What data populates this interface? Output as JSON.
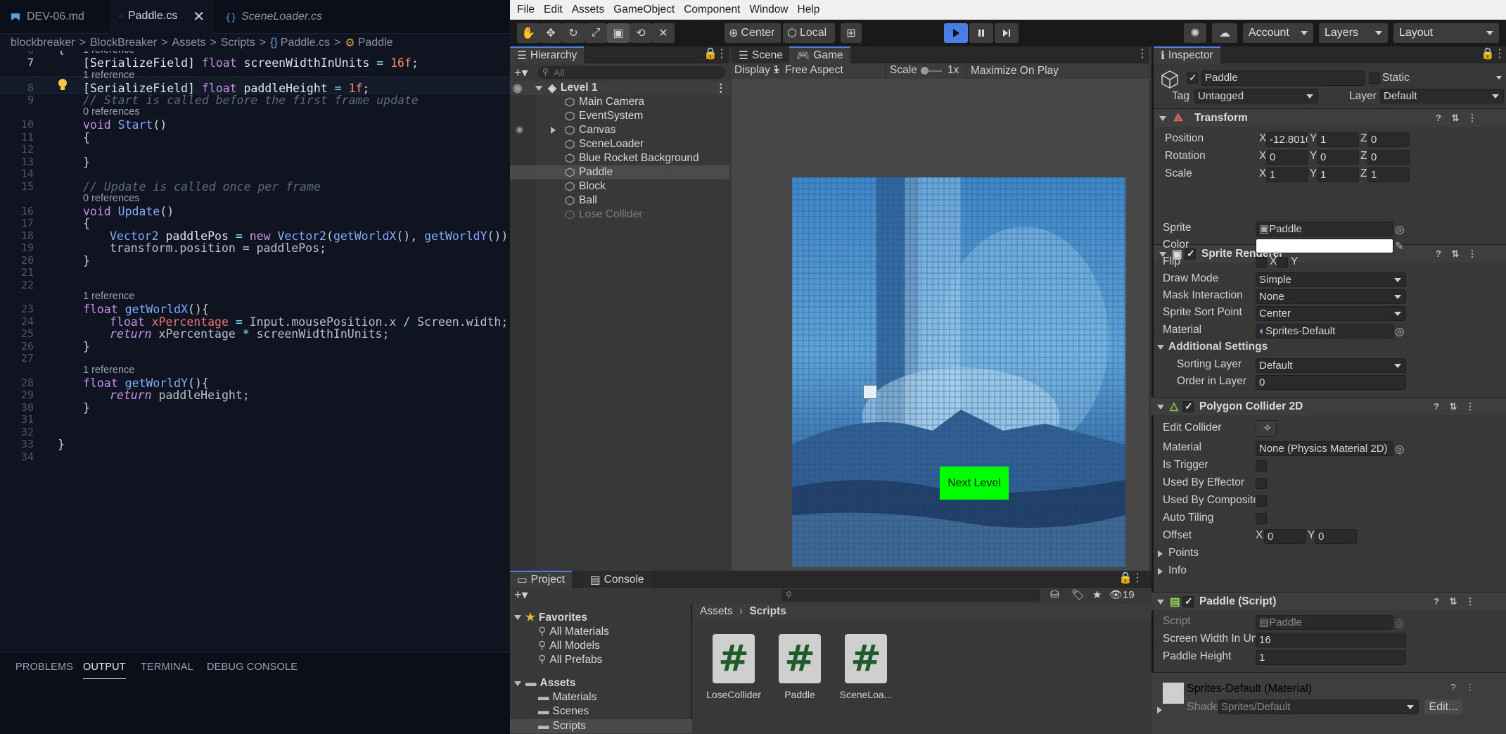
{
  "vscode": {
    "tabs": [
      {
        "label": "DEV-06.md",
        "italic": false
      },
      {
        "label": "Paddle.cs",
        "italic": false
      },
      {
        "label": "SceneLoader.cs",
        "italic": true
      }
    ],
    "breadcrumb": [
      "blockbreaker",
      "BlockBreaker",
      "Assets",
      "Scripts",
      "Paddle.cs",
      "Paddle"
    ],
    "breadcrumb_sep": ">",
    "line_numbers": [
      "6",
      "7",
      "8",
      "9",
      "10",
      "11",
      "12",
      "13",
      "14",
      "15",
      "16",
      "17",
      "18",
      "19",
      "20",
      "21",
      "22",
      "23",
      "24",
      "25",
      "26",
      "27",
      "28",
      "29",
      "30",
      "31",
      "32",
      "33",
      "34"
    ],
    "codelens": {
      "one_ref": "1 reference",
      "zero_ref": "0 references"
    },
    "code": {
      "l6": "{",
      "l7a": "[SerializeField] ",
      "l7b": "float ",
      "l7c": "screenWidthInUnits",
      "l7d": " = ",
      "l7e": "16f",
      "l7f": ";",
      "l8a": "[SerializeField] ",
      "l8b": "float ",
      "l8c": "paddleHeight",
      "l8d": " = ",
      "l8e": "1f",
      "l8f": ";",
      "l9": "// Start is called before the first frame update",
      "l10a": "void ",
      "l10b": "Start",
      "l10c": "()",
      "l11": "{",
      "l13": "}",
      "l15": "// Update is called once per frame",
      "l16a": "void ",
      "l16b": "Update",
      "l16c": "()",
      "l17": "{",
      "l18a": "Vector2 ",
      "l18b": "paddlePos",
      "l18c": " = ",
      "l18d": "new ",
      "l18e": "Vector2",
      "l18f": "(",
      "l18g": "getWorldX",
      "l18h": "(), ",
      "l18i": "getWorldY",
      "l18j": "());",
      "l19": "transform.position = paddlePos;",
      "l20": "}",
      "l23a": "float ",
      "l23b": "getWorldX",
      "l23c": "(){",
      "l24a": "float ",
      "l24b": "xPercentage",
      "l24c": " = ",
      "l24d": "Input.mousePosition.x ",
      "l24e": "/",
      "l24f": " Screen.width;",
      "l25a": "return ",
      "l25b": "xPercentage ",
      "l25c": "*",
      "l25d": " screenWidthInUnits;",
      "l26": "}",
      "l28a": "float ",
      "l28b": "getWorldY",
      "l28c": "(){",
      "l29a": "return ",
      "l29b": "paddleHeight;",
      "l30": "}",
      "l33": "}"
    },
    "panel_tabs": [
      "PROBLEMS",
      "OUTPUT",
      "TERMINAL",
      "DEBUG CONSOLE"
    ]
  },
  "unity": {
    "menu": [
      "File",
      "Edit",
      "Assets",
      "GameObject",
      "Component",
      "Window",
      "Help"
    ],
    "toolbar": {
      "center": "Center",
      "local": "Local",
      "account": "Account",
      "layers": "Layers",
      "layout": "Layout"
    },
    "hierarchy": {
      "title": "Hierarchy",
      "search_placeholder": "All",
      "scene": "Level 1",
      "items": [
        "Main Camera",
        "EventSystem",
        "Canvas",
        "SceneLoader",
        "Blue Rocket Background",
        "Paddle",
        "Block",
        "Ball",
        "Lose Collider"
      ]
    },
    "game": {
      "tab_scene": "Scene",
      "tab_game": "Game",
      "display": "Display 1",
      "aspect": "Free Aspect",
      "scale_label": "Scale",
      "scale_value": "1x",
      "maximize": "Maximize On Play",
      "next_level": "Next Level"
    },
    "project": {
      "tab_project": "Project",
      "tab_console": "Console",
      "count": "19",
      "favorites": "Favorites",
      "fav_items": [
        "All Materials",
        "All Models",
        "All Prefabs"
      ],
      "assets": "Assets",
      "folders": [
        "Materials",
        "Scenes",
        "Scripts"
      ],
      "breadcrumb_root": "Assets",
      "breadcrumb_leaf": "Scripts",
      "files": [
        "LoseCollider",
        "Paddle",
        "SceneLoa..."
      ],
      "file_glyph": "#"
    },
    "inspector": {
      "title": "Inspector",
      "object_name": "Paddle",
      "static": "Static",
      "tag_label": "Tag",
      "tag": "Untagged",
      "layer_label": "Layer",
      "layer": "Default",
      "transform": {
        "title": "Transform",
        "position": {
          "label": "Position",
          "x": "-12.80169",
          "y": "1",
          "z": "0"
        },
        "rotation": {
          "label": "Rotation",
          "x": "0",
          "y": "0",
          "z": "0"
        },
        "scale": {
          "label": "Scale",
          "x": "1",
          "y": "1",
          "z": "1"
        }
      },
      "axis": {
        "x": "X",
        "y": "Y",
        "z": "Z"
      },
      "sprite_renderer": {
        "title": "Sprite Renderer",
        "sprite_label": "Sprite",
        "sprite": "Paddle",
        "color_label": "Color",
        "color": "#ffffff",
        "flip_label": "Flip",
        "draw_mode_label": "Draw Mode",
        "draw_mode": "Simple",
        "mask_label": "Mask Interaction",
        "mask": "None",
        "sort_point_label": "Sprite Sort Point",
        "sort_point": "Center",
        "material_label": "Material",
        "material": "Sprites-Default",
        "additional": "Additional Settings",
        "sorting_layer_label": "Sorting Layer",
        "sorting_layer": "Default",
        "order_label": "Order in Layer",
        "order": "0"
      },
      "polygon_collider": {
        "title": "Polygon Collider 2D",
        "edit_label": "Edit Collider",
        "material_label": "Material",
        "material": "None (Physics Material 2D)",
        "trigger_label": "Is Trigger",
        "effector_label": "Used By Effector",
        "composite_label": "Used By Composite",
        "tiling_label": "Auto Tiling",
        "offset_label": "Offset",
        "offset_x": "0",
        "offset_y": "0",
        "points": "Points",
        "info": "Info"
      },
      "paddle_script": {
        "title": "Paddle (Script)",
        "script_label": "Script",
        "script": "Paddle",
        "width_label": "Screen Width In Units",
        "width": "16",
        "height_label": "Paddle Height",
        "height": "1"
      },
      "material_footer": {
        "name": "Sprites-Default (Material)",
        "shader_label": "Shader",
        "shader": "Sprites/Default",
        "edit": "Edit..."
      }
    },
    "colors": {
      "accent": "#4c7ce5",
      "next_level_bg": "#00ff00"
    }
  }
}
